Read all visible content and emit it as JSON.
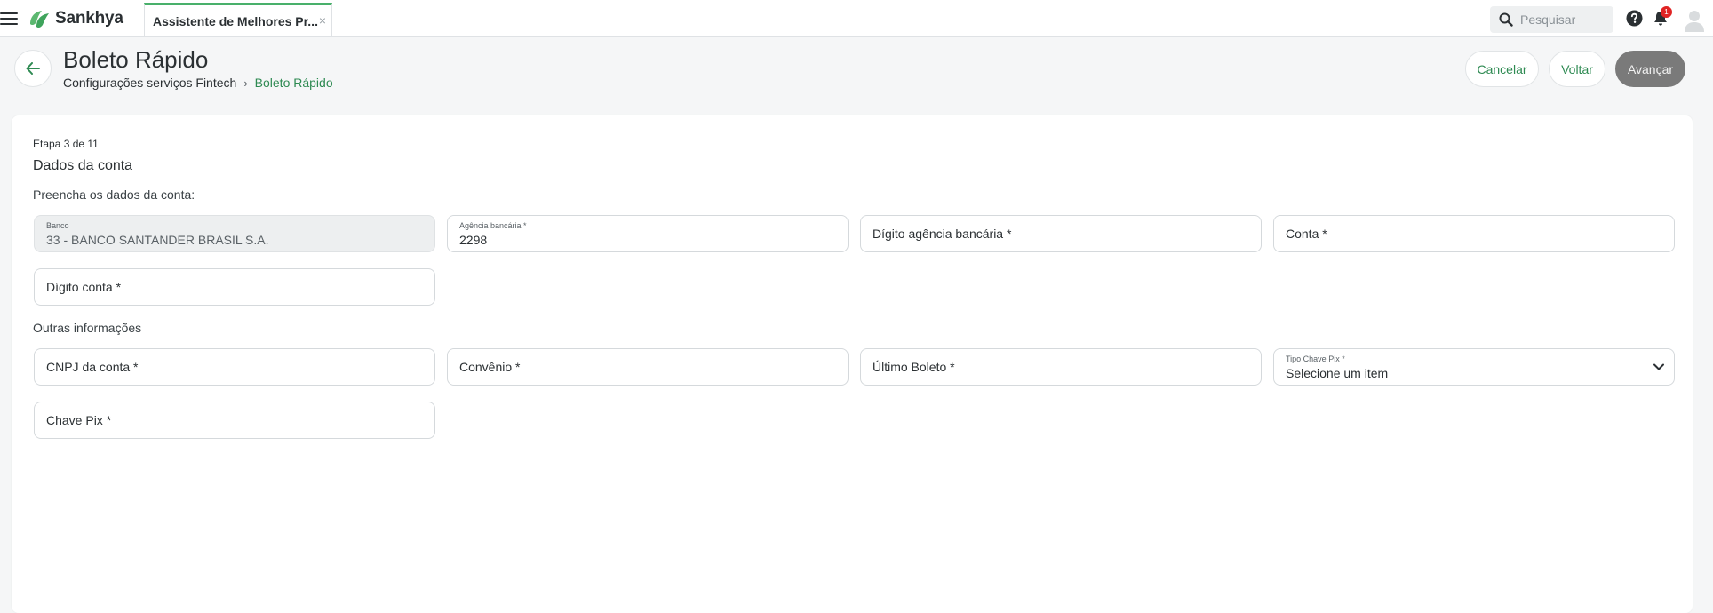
{
  "topbar": {
    "brand": "Sankhya",
    "tab_label": "Assistente de Melhores Pr...",
    "tab_close": "×",
    "search_placeholder": "Pesquisar",
    "notification_count": "1"
  },
  "header": {
    "title": "Boleto Rápido",
    "breadcrumb_parent": "Configurações serviços Fintech",
    "breadcrumb_separator": "›",
    "breadcrumb_current": "Boleto Rápido",
    "cancel_label": "Cancelar",
    "back_label": "Voltar",
    "next_label": "Avançar"
  },
  "form": {
    "step": "Etapa 3 de 11",
    "section_title": "Dados da conta",
    "instruction": "Preencha os dados da conta:",
    "bank": {
      "label": "Banco",
      "value": "33 - BANCO SANTANDER BRASIL S.A."
    },
    "agency": {
      "label": "Agência bancária *",
      "value": "2298"
    },
    "agency_digit": {
      "placeholder": "Dígito agência bancária *"
    },
    "account": {
      "placeholder": "Conta *"
    },
    "account_digit": {
      "placeholder": "Dígito conta *"
    },
    "other_title": "Outras informações",
    "cnpj": {
      "placeholder": "CNPJ da conta *"
    },
    "agreement": {
      "placeholder": "Convênio *"
    },
    "last_boleto": {
      "placeholder": "Último Boleto *"
    },
    "pix_key_type": {
      "label": "Tipo Chave Pix *",
      "value": "Selecione um item"
    },
    "pix_key": {
      "placeholder": "Chave Pix *"
    }
  },
  "colors": {
    "brand_green": "#49b06b",
    "link_green": "#2e8a52",
    "disabled_button": "#7a7a7a",
    "badge_red": "#e02424"
  },
  "icons": [
    "menu-icon",
    "sankhya-logo-icon",
    "search-icon",
    "help-icon",
    "bell-icon",
    "avatar-icon",
    "arrow-left-icon",
    "chevron-right-icon",
    "chevron-down-icon"
  ]
}
